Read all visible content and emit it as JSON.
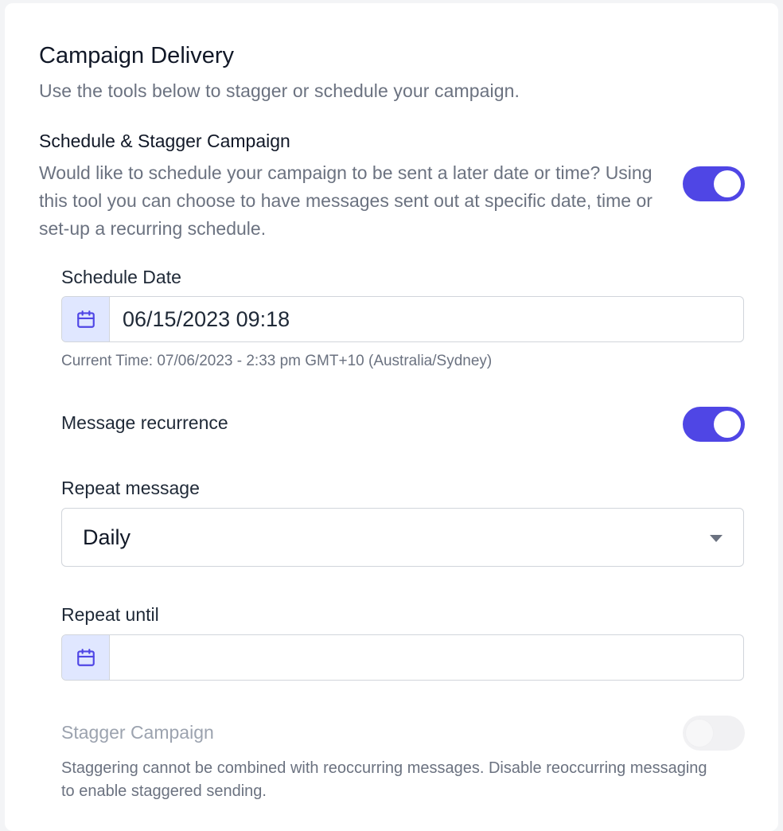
{
  "section": {
    "title": "Campaign Delivery",
    "subtitle": "Use the tools below to stagger or schedule your campaign."
  },
  "schedule": {
    "title": "Schedule & Stagger Campaign",
    "description": "Would like to schedule your campaign to be sent a later date or time? Using this tool you can choose to have messages sent out at specific date, time or set-up a recurring schedule.",
    "enabled": true
  },
  "schedule_date": {
    "label": "Schedule Date",
    "value": "06/15/2023 09:18",
    "icon": "calendar-icon",
    "hint": "Current Time: 07/06/2023 - 2:33 pm GMT+10 (Australia/Sydney)"
  },
  "recurrence": {
    "label": "Message recurrence",
    "enabled": true
  },
  "repeat_message": {
    "label": "Repeat message",
    "selected": "Daily"
  },
  "repeat_until": {
    "label": "Repeat until",
    "value": "",
    "icon": "calendar-icon"
  },
  "stagger": {
    "label": "Stagger Campaign",
    "enabled": false,
    "disabled": true,
    "description": "Staggering cannot be combined with reoccurring messages. Disable reoccurring messaging to enable staggered sending."
  },
  "colors": {
    "accent": "#4f46e5",
    "addon_bg": "#e0e7ff"
  }
}
